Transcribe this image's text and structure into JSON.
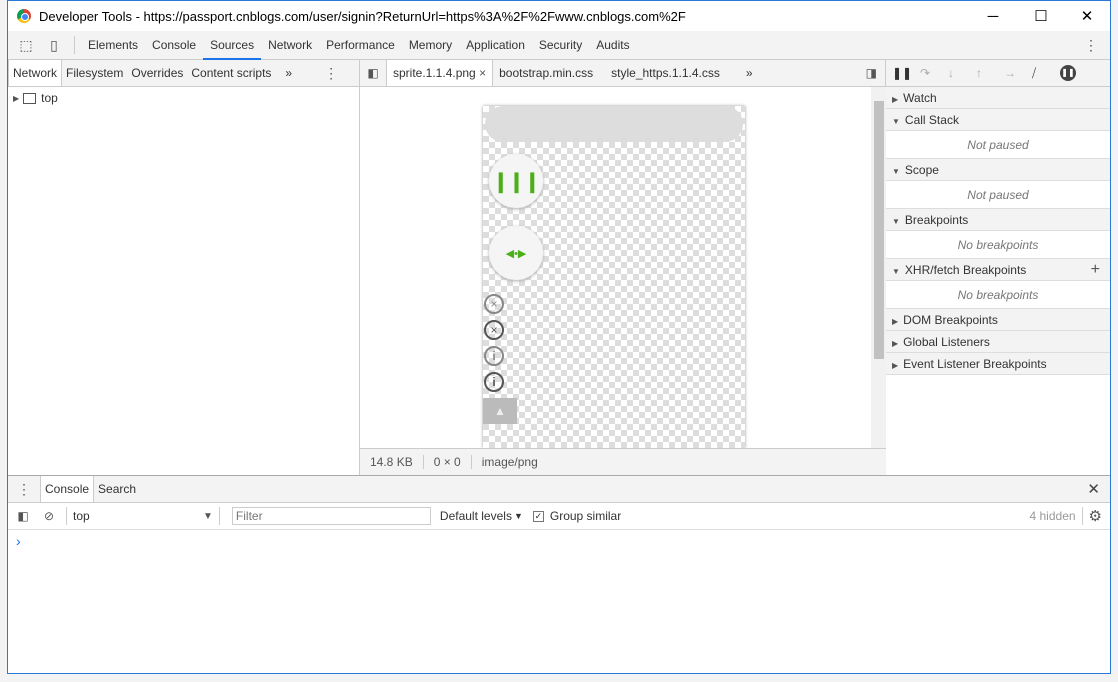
{
  "window": {
    "title": "Developer Tools - https://passport.cnblogs.com/user/signin?ReturnUrl=https%3A%2F%2Fwww.cnblogs.com%2F",
    "minimize": "─",
    "maximize": "☐",
    "close": "✕"
  },
  "toolbar": {
    "tabs": [
      "Elements",
      "Console",
      "Sources",
      "Network",
      "Performance",
      "Memory",
      "Application",
      "Security",
      "Audits"
    ],
    "active": "Sources"
  },
  "navigator": {
    "tabs": [
      "Network",
      "Filesystem",
      "Overrides",
      "Content scripts"
    ],
    "more": "»",
    "tree": [
      {
        "label": "top"
      }
    ]
  },
  "editor": {
    "tabs": [
      "sprite.1.1.4.png",
      "bootstrap.min.css",
      "style_https.1.1.4.css"
    ],
    "more": "»",
    "status": {
      "size": "14.8 KB",
      "dimensions": "0 × 0",
      "mime": "image/png"
    }
  },
  "debugger": {
    "sections": [
      {
        "label": "Watch",
        "expanded": false
      },
      {
        "label": "Call Stack",
        "expanded": true,
        "empty": "Not paused"
      },
      {
        "label": "Scope",
        "expanded": true,
        "empty": "Not paused"
      },
      {
        "label": "Breakpoints",
        "expanded": true,
        "empty": "No breakpoints"
      },
      {
        "label": "XHR/fetch Breakpoints",
        "expanded": true,
        "empty": "No breakpoints"
      },
      {
        "label": "DOM Breakpoints",
        "expanded": false
      },
      {
        "label": "Global Listeners",
        "expanded": false
      },
      {
        "label": "Event Listener Breakpoints",
        "expanded": false
      }
    ]
  },
  "drawer": {
    "tabs": [
      "Console",
      "Search"
    ],
    "context": "top",
    "filter_placeholder": "Filter",
    "levels": "Default levels",
    "group_similar": "Group similar",
    "group_checked": true,
    "hidden": "4 hidden",
    "prompt": "›"
  },
  "colors": {
    "accent": "#1a73e8",
    "sprite_green": "#4caf1a"
  }
}
